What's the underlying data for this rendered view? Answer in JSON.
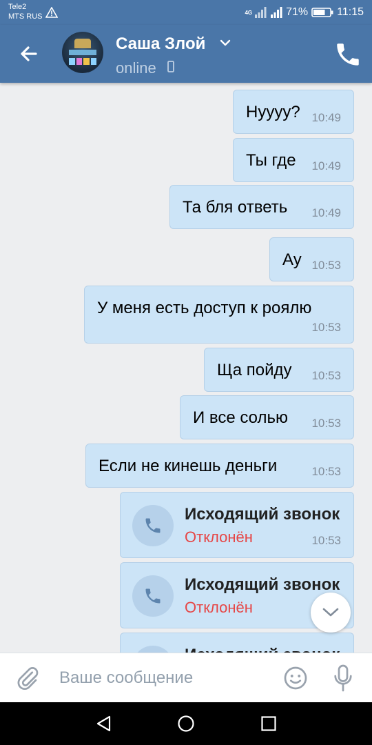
{
  "status_bar": {
    "carrier_line1": "Tele2",
    "carrier_line2": "MTS RUS",
    "network": "4G",
    "battery_percent": "71%",
    "time": "11:15"
  },
  "header": {
    "contact_name": "Саша Злой",
    "status": "online"
  },
  "messages": [
    {
      "text": "Нуууу?",
      "time": "10:49"
    },
    {
      "text": "Ты где",
      "time": "10:49"
    },
    {
      "text": "Та бля ответь",
      "time": "10:49"
    },
    {
      "text": "Ау",
      "time": "10:53"
    },
    {
      "text": "У меня есть доступ к роялю",
      "time": "10:53"
    },
    {
      "text": "Ща пойду",
      "time": "10:53"
    },
    {
      "text": "И все солью",
      "time": "10:53"
    },
    {
      "text": "Если не кинешь деньги",
      "time": "10:53"
    }
  ],
  "calls": [
    {
      "title": "Исходящий звонок",
      "status": "Отклонён",
      "time": "10:53"
    },
    {
      "title": "Исходящий звонок",
      "status": "Отклонён",
      "time": ""
    },
    {
      "title": "Исходящий звонок",
      "status": "",
      "time": ""
    }
  ],
  "composer": {
    "placeholder": "Ваше сообщение"
  },
  "colors": {
    "header_bg": "#4a76a8",
    "bubble_bg": "#cce4f7",
    "declined": "#e64646"
  },
  "icons": [
    "back-arrow-icon",
    "chevron-down-icon",
    "phone-icon",
    "paperclip-icon",
    "smiley-icon",
    "microphone-icon",
    "nav-back-icon",
    "nav-home-icon",
    "nav-recent-icon"
  ]
}
